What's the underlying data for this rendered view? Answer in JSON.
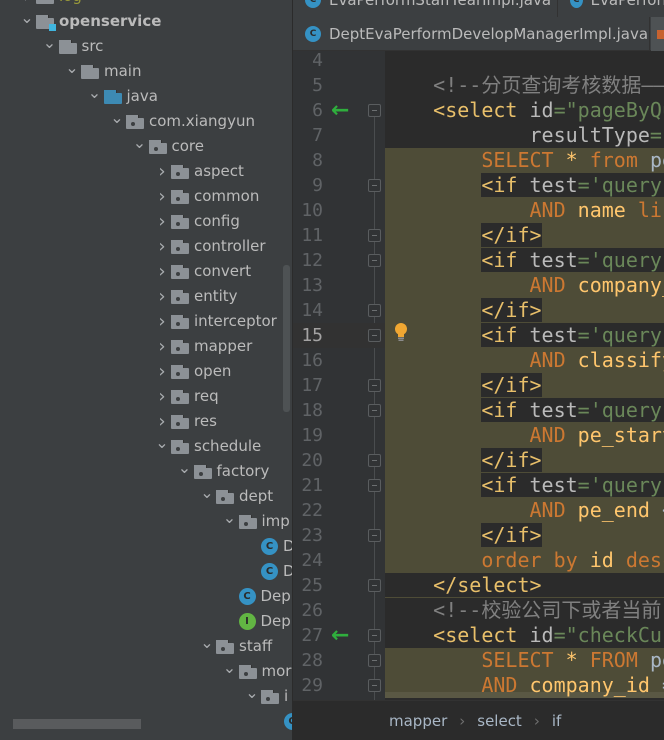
{
  "project_tree": [
    {
      "level": 0,
      "label": "log",
      "type": "folder",
      "expanded": false,
      "partial": true,
      "color": "#9a9a3a"
    },
    {
      "level": 0,
      "label": "openservice",
      "type": "module",
      "expanded": true,
      "bold": true
    },
    {
      "level": 1,
      "label": "src",
      "type": "folder",
      "expanded": true
    },
    {
      "level": 2,
      "label": "main",
      "type": "folder",
      "expanded": true
    },
    {
      "level": 3,
      "label": "java",
      "type": "source-root",
      "expanded": true
    },
    {
      "level": 4,
      "label": "com.xiangyun",
      "type": "package",
      "expanded": true
    },
    {
      "level": 5,
      "label": "core",
      "type": "package",
      "expanded": true
    },
    {
      "level": 6,
      "label": "aspect",
      "type": "package",
      "expanded": false
    },
    {
      "level": 6,
      "label": "common",
      "type": "package",
      "expanded": false
    },
    {
      "level": 6,
      "label": "config",
      "type": "package",
      "expanded": false
    },
    {
      "level": 6,
      "label": "controller",
      "type": "package",
      "expanded": false
    },
    {
      "level": 6,
      "label": "convert",
      "type": "package",
      "expanded": false
    },
    {
      "level": 6,
      "label": "entity",
      "type": "package",
      "expanded": false
    },
    {
      "level": 6,
      "label": "interceptor",
      "type": "package",
      "expanded": false
    },
    {
      "level": 6,
      "label": "mapper",
      "type": "package",
      "expanded": false
    },
    {
      "level": 6,
      "label": "open",
      "type": "package",
      "expanded": false
    },
    {
      "level": 6,
      "label": "req",
      "type": "package",
      "expanded": false
    },
    {
      "level": 6,
      "label": "res",
      "type": "package",
      "expanded": false
    },
    {
      "level": 6,
      "label": "schedule",
      "type": "package",
      "expanded": true
    },
    {
      "level": 7,
      "label": "factory",
      "type": "package",
      "expanded": true
    },
    {
      "level": 8,
      "label": "dept",
      "type": "package",
      "expanded": true
    },
    {
      "level": 9,
      "label": "imp",
      "type": "package",
      "expanded": true
    },
    {
      "level": 10,
      "label": "D",
      "type": "class"
    },
    {
      "level": 10,
      "label": "D",
      "type": "class"
    },
    {
      "level": 9,
      "label": "Dep",
      "type": "class"
    },
    {
      "level": 9,
      "label": "Dep",
      "type": "interface"
    },
    {
      "level": 8,
      "label": "staff",
      "type": "package",
      "expanded": true
    },
    {
      "level": 9,
      "label": "mor",
      "type": "package",
      "expanded": true
    },
    {
      "level": 10,
      "label": "i",
      "type": "package",
      "expanded": true
    },
    {
      "level": 11,
      "label": "",
      "type": "class"
    }
  ],
  "tabs": [
    {
      "label": "EvaPerformStaffYearImpl.java",
      "icon": "class-icon",
      "row": 1
    },
    {
      "label": "EvaPerform",
      "icon": "class-icon",
      "row": 1
    },
    {
      "label": "DeptEvaPerformDevelopManagerImpl.java",
      "icon": "class-icon",
      "row": 2
    }
  ],
  "editor": {
    "first_line": 4,
    "current_line": 15,
    "gutter_arrows": [
      6,
      27
    ],
    "fold_markers": [
      6,
      9,
      11,
      12,
      14,
      15,
      17,
      18,
      20,
      21,
      23,
      25,
      27,
      28,
      29
    ],
    "injected_lines": [
      8,
      9,
      10,
      11,
      12,
      13,
      14,
      15,
      16,
      17,
      18,
      19,
      20,
      21,
      22,
      23,
      24,
      28,
      29
    ],
    "colors": {
      "tag": "#e8bf6a",
      "keyword": "#cc7832",
      "string": "#6a8759",
      "comment": "#808080",
      "injected_bg": "#4e4c37"
    },
    "lines": [
      [],
      [
        [
          "ws",
          "    "
        ],
        [
          "com",
          "<!--分页查询考核数据——"
        ]
      ],
      [
        [
          "ws",
          "    "
        ],
        [
          "tag",
          "<select "
        ],
        [
          "attr",
          "id"
        ],
        [
          "str",
          "=\"pageByQu"
        ]
      ],
      [
        [
          "ws",
          "            "
        ],
        [
          "attr",
          "resultType"
        ],
        [
          "str",
          "=\""
        ]
      ],
      [
        [
          "ws",
          "        "
        ],
        [
          "kw",
          "SELECT "
        ],
        [
          "id",
          "* "
        ],
        [
          "kw",
          "from "
        ],
        [
          "pl",
          "pe"
        ]
      ],
      [
        [
          "ws",
          "        "
        ],
        [
          "tag",
          "<if "
        ],
        [
          "attr",
          "test"
        ],
        [
          "str",
          "='query."
        ]
      ],
      [
        [
          "ws",
          "            "
        ],
        [
          "kw",
          "AND "
        ],
        [
          "id",
          "name "
        ],
        [
          "kw",
          "lik"
        ]
      ],
      [
        [
          "ws",
          "        "
        ],
        [
          "tag",
          "</if>"
        ]
      ],
      [
        [
          "ws",
          "        "
        ],
        [
          "tag",
          "<if "
        ],
        [
          "attr",
          "test"
        ],
        [
          "str",
          "='query."
        ]
      ],
      [
        [
          "ws",
          "            "
        ],
        [
          "kw",
          "AND "
        ],
        [
          "id",
          "company_"
        ]
      ],
      [
        [
          "ws",
          "        "
        ],
        [
          "tag",
          "</if>"
        ]
      ],
      [
        [
          "ws",
          "        "
        ],
        [
          "tag",
          "<if "
        ],
        [
          "attr",
          "test"
        ],
        [
          "str",
          "='query."
        ]
      ],
      [
        [
          "ws",
          "            "
        ],
        [
          "kw",
          "AND "
        ],
        [
          "id",
          "classify"
        ]
      ],
      [
        [
          "ws",
          "        "
        ],
        [
          "tag",
          "</if>"
        ]
      ],
      [
        [
          "ws",
          "        "
        ],
        [
          "tag",
          "<if "
        ],
        [
          "attr",
          "test"
        ],
        [
          "str",
          "='query."
        ]
      ],
      [
        [
          "ws",
          "            "
        ],
        [
          "kw",
          "AND "
        ],
        [
          "id",
          "pe_start"
        ]
      ],
      [
        [
          "ws",
          "        "
        ],
        [
          "tag",
          "</if>"
        ]
      ],
      [
        [
          "ws",
          "        "
        ],
        [
          "tag",
          "<if "
        ],
        [
          "attr",
          "test"
        ],
        [
          "str",
          "='query."
        ]
      ],
      [
        [
          "ws",
          "            "
        ],
        [
          "kw",
          "AND "
        ],
        [
          "id",
          "pe_end "
        ],
        [
          "pl",
          "<"
        ]
      ],
      [
        [
          "ws",
          "        "
        ],
        [
          "tag",
          "</if>"
        ]
      ],
      [
        [
          "ws",
          "        "
        ],
        [
          "kw",
          "order by "
        ],
        [
          "id",
          "id "
        ],
        [
          "kw",
          "desc"
        ]
      ],
      [
        [
          "dk",
          "    "
        ],
        [
          "tag",
          "</select>"
        ]
      ],
      [
        [
          "ws",
          "    "
        ],
        [
          "com",
          "<!--校验公司下或者当前"
        ]
      ],
      [
        [
          "ws",
          "    "
        ],
        [
          "tag",
          "<select "
        ],
        [
          "attr",
          "id"
        ],
        [
          "str",
          "=\"checkCur"
        ]
      ],
      [
        [
          "ws",
          "        "
        ],
        [
          "kw",
          "SELECT "
        ],
        [
          "id",
          "* "
        ],
        [
          "kw",
          "FROM "
        ],
        [
          "pl",
          "pe"
        ]
      ],
      [
        [
          "ws",
          "        "
        ],
        [
          "kw",
          "AND "
        ],
        [
          "id",
          "company_id "
        ],
        [
          "pl",
          "="
        ]
      ]
    ]
  },
  "breadcrumb": [
    "mapper",
    "select",
    "if"
  ]
}
